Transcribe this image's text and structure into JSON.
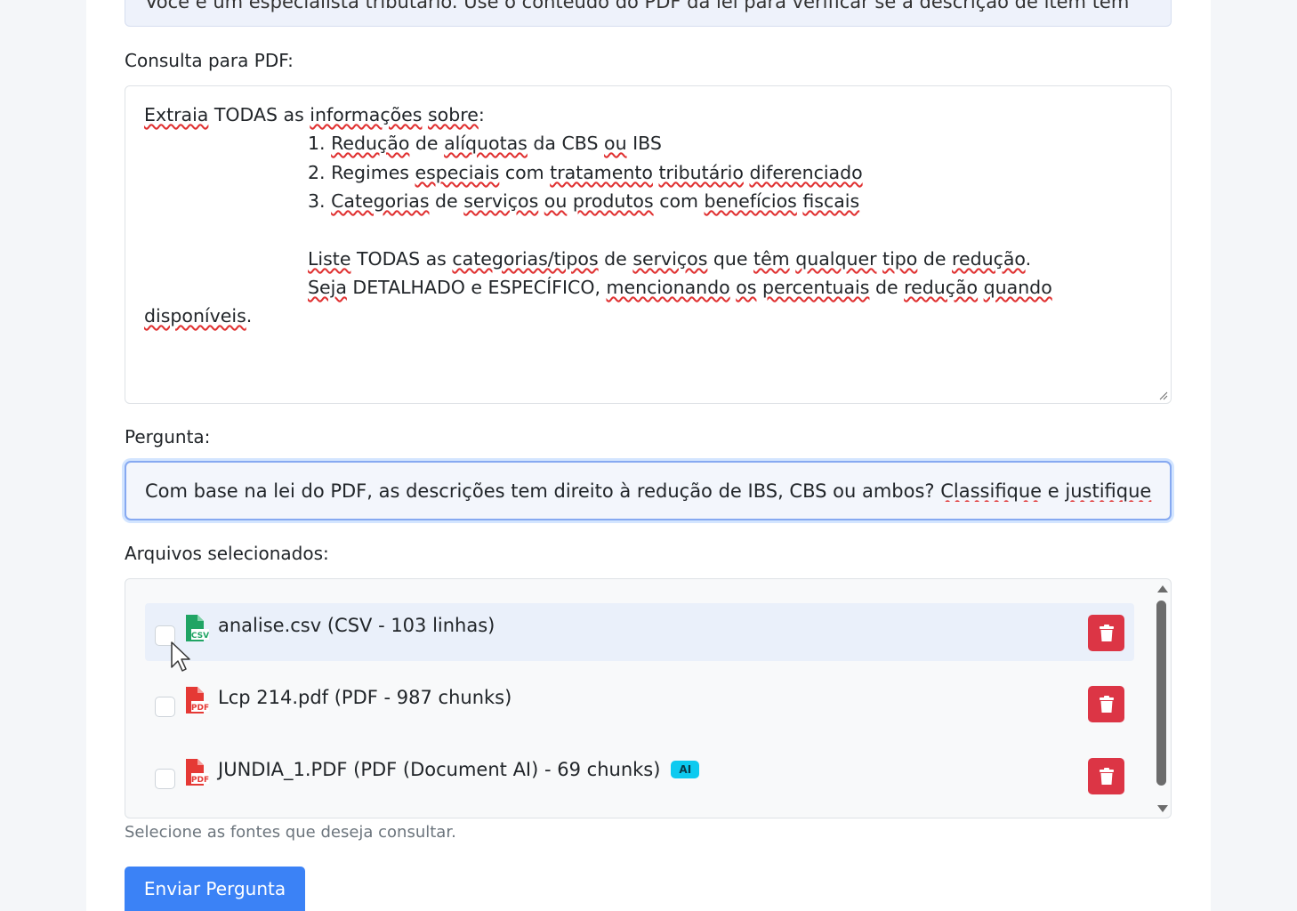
{
  "previous_field": {
    "text": "Você é um especialista tributário. Use o conteúdo do PDF da lei para verificar se a descrição de item tem"
  },
  "pdf_query": {
    "label": "Consulta para PDF:",
    "lines": [
      [
        "Extraia",
        " TODAS as ",
        "informações",
        " ",
        "sobre",
        ":"
      ],
      [
        "1. ",
        "Redução",
        " de ",
        "alíquotas",
        " da CBS ",
        "ou",
        " IBS"
      ],
      [
        "2. Regimes ",
        "especiais",
        " com ",
        "tratamento",
        " ",
        "tributário",
        " ",
        "diferenciado"
      ],
      [
        "3. ",
        "Categorias",
        " de ",
        "serviços",
        " ",
        "ou",
        " ",
        "produtos",
        " com ",
        "benefícios",
        " ",
        "fiscais"
      ],
      [
        "Liste",
        " TODAS as ",
        "categorias/tipos",
        " de ",
        "serviços",
        " que ",
        "têm",
        " ",
        "qualquer",
        " ",
        "tipo",
        " de ",
        "redução",
        "."
      ],
      [
        "Seja",
        " DETALHADO e ESPECÍFICO, ",
        "mencionando",
        " ",
        "os",
        " ",
        "percentuais",
        " de ",
        "redução",
        " ",
        "quando"
      ],
      [
        "disponíveis",
        "."
      ]
    ]
  },
  "question": {
    "label": "Pergunta:",
    "value_plain": "Com base na lei do PDF, as descrições tem direito à redução de IBS, CBS ou ambos? ",
    "value_misspelled_1": "Classifique",
    "value_mid": " e ",
    "value_misspelled_2": "justifique"
  },
  "files": {
    "label": "Arquivos selecionados:",
    "items": [
      {
        "name": "analise.csv (CSV - 103 linhas)",
        "icon": "csv-file-icon",
        "icon_color": "#20a464",
        "icon_text": "CSV",
        "badge": ""
      },
      {
        "name": "Lcp 214.pdf (PDF - 987 chunks)",
        "icon": "pdf-file-icon",
        "icon_color": "#e53935",
        "icon_text": "PDF",
        "badge": ""
      },
      {
        "name": "JUNDIA_1.PDF (PDF (Document AI) - 69 chunks)",
        "icon": "pdf-file-icon",
        "icon_color": "#e53935",
        "icon_text": "PDF",
        "badge": "AI"
      }
    ],
    "help_text": "Selecione as fontes que deseja consultar."
  },
  "submit": {
    "label": "Enviar Pergunta"
  },
  "colors": {
    "accent": "#3b82f6",
    "danger": "#dc3545",
    "badge": "#0dcaf0"
  }
}
